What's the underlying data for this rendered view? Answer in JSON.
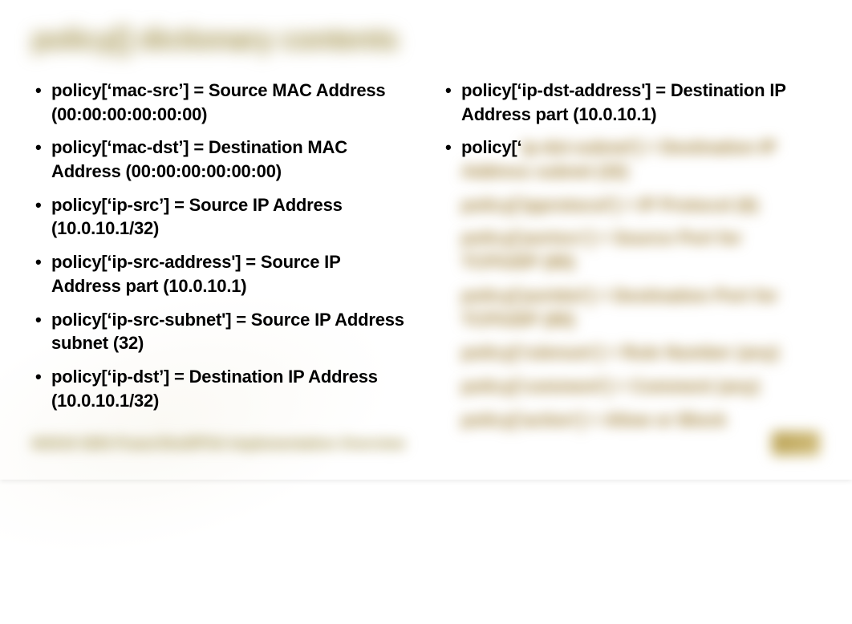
{
  "slide": {
    "title": "policy[] dictionary contents",
    "left_items": [
      "policy[‘mac-src’] = Source MAC Address   (00:00:00:00:00:00)",
      "policy[‘mac-dst’] = Destination MAC Address  (00:00:00:00:00:00)",
      "policy[‘ip-src’] = Source IP Address (10.0.10.1/32)",
      "policy[‘ip-src-address'] = Source IP Address part (10.0.10.1)",
      "policy[‘ip-src-subnet'] = Source IP Address subnet (32)",
      "policy[‘ip-dst’] = Destination IP Address (10.0.10.1/32)"
    ],
    "right_visible": [
      "policy[‘ip-dst-address'] = Destination IP Address part (10.0.10.1)"
    ],
    "right_partial_prefix": "policy[‘",
    "right_partial_blurred_tail": "ip-dst-subnet'] = Destination IP Address subnet (32)",
    "right_blurred": [
      "policy['ipprotocol'] = IP Protocol (6)",
      "policy['portsrc'] = Source Port for TCP/UDP (80)",
      "policy['portdst'] = Destination Port for TCP/UDP (80)",
      "policy['rulenum'] = Rule Number (any)",
      "policy['comment'] = Comment (any)",
      "policy['action'] = Allow or Block"
    ],
    "footer_text": "8/2019   SDN PowerShell/PSA   Implementation Overview"
  }
}
